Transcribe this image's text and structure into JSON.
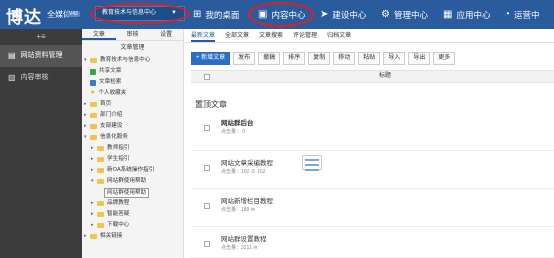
{
  "header": {
    "logo": "博达",
    "logo_sub": "全媒体",
    "version": "V42",
    "site_selector": "教育技术与信息中心",
    "nav": [
      {
        "label": "我的桌面",
        "icon": "grid-icon"
      },
      {
        "label": "内容中心",
        "icon": "content-icon"
      },
      {
        "label": "建设中心",
        "icon": "send-icon"
      },
      {
        "label": "管理中心",
        "icon": "gear-icon"
      },
      {
        "label": "应用中心",
        "icon": "apps-icon"
      },
      {
        "label": "运营中",
        "icon": "operations-icon"
      }
    ],
    "highlight_color": "#e02020",
    "bar_color": "#2a5b9c"
  },
  "sidebar": {
    "items": [
      {
        "label": "网站资料管理",
        "icon": "document-icon"
      },
      {
        "label": "内容审核",
        "icon": "audit-icon"
      }
    ]
  },
  "tree": {
    "tabs": [
      "文章",
      "审核",
      "设置"
    ],
    "title": "文章管理",
    "nodes": [
      {
        "label": "教育技术与信息中心",
        "kind": "root",
        "toggle": "▾"
      },
      {
        "label": "共享文章",
        "kind": "green"
      },
      {
        "label": "文章检索",
        "kind": "blue"
      },
      {
        "label": "个人收藏夹",
        "kind": "star"
      },
      {
        "label": "首页",
        "kind": "folder",
        "toggle": "▸"
      },
      {
        "label": "部门介绍",
        "kind": "folder",
        "toggle": "▸"
      },
      {
        "label": "支部建设",
        "kind": "folder",
        "toggle": "▸"
      },
      {
        "label": "信息化服务",
        "kind": "folder",
        "toggle": "▾"
      },
      {
        "label": "教师指引",
        "kind": "folder",
        "toggle": "▸",
        "indent": 1
      },
      {
        "label": "学生指引",
        "kind": "folder",
        "toggle": "▸",
        "indent": 1
      },
      {
        "label": "新OA系统操作指引",
        "kind": "folder",
        "toggle": "▸",
        "indent": 1
      },
      {
        "label": "网站群使用帮助",
        "kind": "folder",
        "toggle": "▾",
        "indent": 1
      },
      {
        "label": "网站群使用帮助",
        "kind": "selected",
        "indent": 2
      },
      {
        "label": "品牌教程",
        "kind": "folder",
        "toggle": "▸",
        "indent": 1
      },
      {
        "label": "智能答疑",
        "kind": "folder",
        "toggle": "▸",
        "indent": 1
      },
      {
        "label": "下载中心",
        "kind": "folder",
        "toggle": "▸",
        "indent": 1
      },
      {
        "label": "相关链接",
        "kind": "folder",
        "toggle": "▸"
      }
    ]
  },
  "main": {
    "tabs": [
      "最新文章",
      "全部文章",
      "文章搜索",
      "评论管理",
      "归档文章"
    ],
    "toolbar": [
      "+ 新增文章",
      "发布",
      "撤稿",
      "排序",
      "复制",
      "移动",
      "粘贴",
      "导入",
      "导出",
      "更多"
    ],
    "column_header": "标题",
    "section_title": "置顶文章",
    "rows": [
      {
        "title": "网站群后台",
        "meta": "点击量： 0",
        "bold": true,
        "thumb": false
      },
      {
        "title": "网站文章采编教程",
        "meta": "点击量：102  ⊘ 152",
        "bold": false,
        "thumb": true
      },
      {
        "title": "网站新增栏目教程",
        "meta": "点击量：189  ✉",
        "bold": false,
        "thumb": false
      },
      {
        "title": "网站群设置教程",
        "meta": "点击量：3211  ✉",
        "bold": false,
        "thumb": false
      }
    ]
  }
}
